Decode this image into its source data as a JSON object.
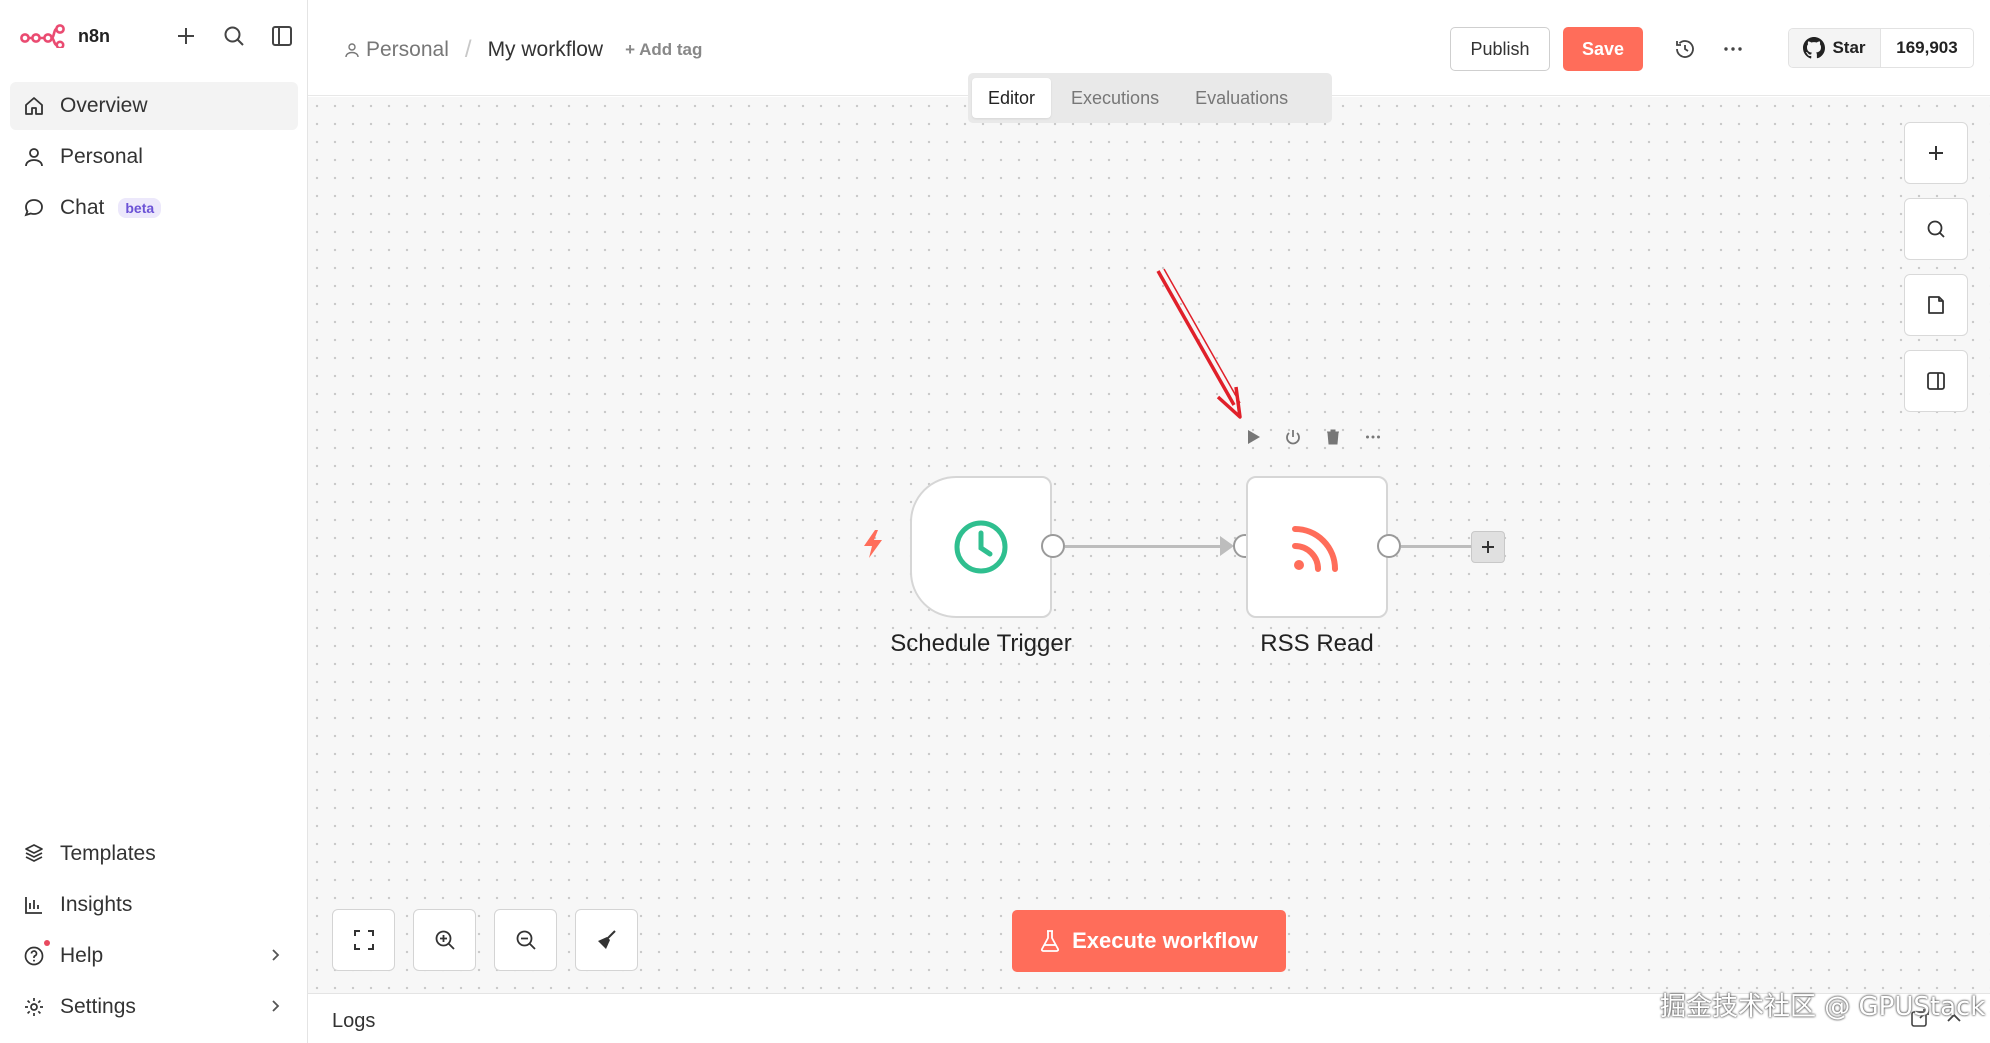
{
  "brand": {
    "name": "n8n",
    "accent": "#ea4b71"
  },
  "sidebar": {
    "top_items": [
      {
        "label": "Overview",
        "icon": "home-icon"
      },
      {
        "label": "Personal",
        "icon": "user-icon"
      },
      {
        "label": "Chat",
        "icon": "chat-icon",
        "badge": "beta"
      }
    ],
    "bottom_items": [
      {
        "label": "Templates",
        "icon": "templates-icon"
      },
      {
        "label": "Insights",
        "icon": "chart-icon"
      },
      {
        "label": "Help",
        "icon": "help-icon"
      },
      {
        "label": "Settings",
        "icon": "gear-icon"
      }
    ]
  },
  "header": {
    "breadcrumb_project": "Personal",
    "workflow_name": "My workflow",
    "add_tag": "+ Add tag",
    "publish_label": "Publish",
    "save_label": "Save",
    "github_star": "Star",
    "github_count": "169,903"
  },
  "tabs": [
    {
      "label": "Editor",
      "active": true
    },
    {
      "label": "Executions",
      "active": false
    },
    {
      "label": "Evaluations",
      "active": false
    }
  ],
  "nodes": [
    {
      "label": "Schedule Trigger",
      "icon": "clock-icon",
      "color": "#2fbf8f"
    },
    {
      "label": "RSS Read",
      "icon": "rss-icon",
      "color": "#ff6d5a"
    }
  ],
  "execute_label": "Execute workflow",
  "logs_label": "Logs",
  "watermark": "掘金技术社区 @ GPUStack",
  "colors": {
    "primary": "#ff6d5a",
    "annotation": "#e0202a"
  }
}
